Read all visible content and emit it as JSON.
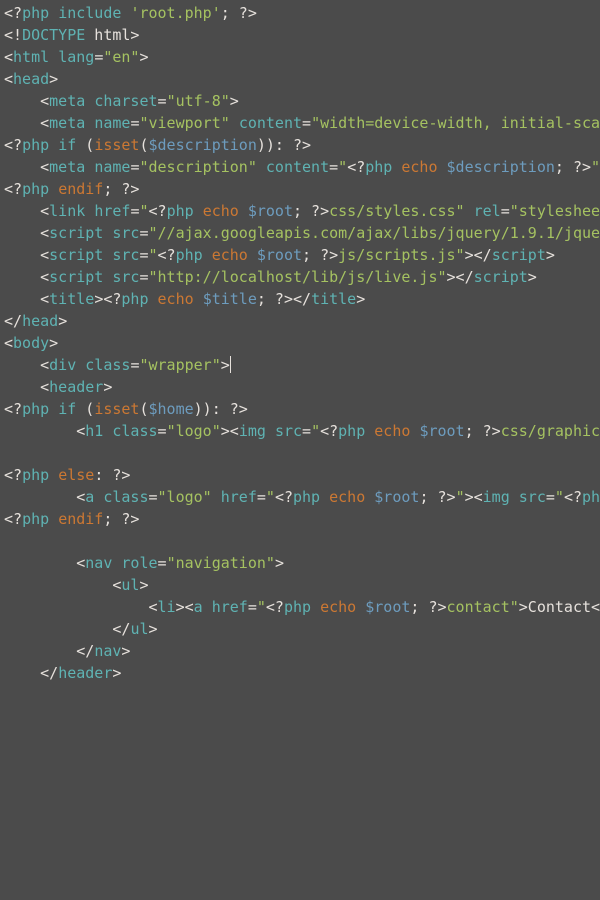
{
  "code": {
    "lines": [
      [
        {
          "cls": "c-punct",
          "t": "<?"
        },
        {
          "cls": "c-tag",
          "t": "php"
        },
        {
          "cls": "c-punct",
          "t": " "
        },
        {
          "cls": "c-tag",
          "t": "include"
        },
        {
          "cls": "c-punct",
          "t": " "
        },
        {
          "cls": "c-string",
          "t": "'root.php'"
        },
        {
          "cls": "c-punct",
          "t": "; ?>"
        }
      ],
      [
        {
          "cls": "c-punct",
          "t": "<!"
        },
        {
          "cls": "c-doctype",
          "t": "DOCTYPE"
        },
        {
          "cls": "c-punct",
          "t": " html>"
        }
      ],
      [
        {
          "cls": "c-punct",
          "t": "<"
        },
        {
          "cls": "c-tag",
          "t": "html"
        },
        {
          "cls": "c-punct",
          "t": " "
        },
        {
          "cls": "c-attr",
          "t": "lang"
        },
        {
          "cls": "c-punct",
          "t": "="
        },
        {
          "cls": "c-string",
          "t": "\"en\""
        },
        {
          "cls": "c-punct",
          "t": ">"
        }
      ],
      [
        {
          "cls": "c-punct",
          "t": "<"
        },
        {
          "cls": "c-tag",
          "t": "head"
        },
        {
          "cls": "c-punct",
          "t": ">"
        }
      ],
      [
        {
          "cls": "c-punct",
          "t": "    <"
        },
        {
          "cls": "c-tag",
          "t": "meta"
        },
        {
          "cls": "c-punct",
          "t": " "
        },
        {
          "cls": "c-attr",
          "t": "charset"
        },
        {
          "cls": "c-punct",
          "t": "="
        },
        {
          "cls": "c-string",
          "t": "\"utf-8\""
        },
        {
          "cls": "c-punct",
          "t": ">"
        }
      ],
      [
        {
          "cls": "c-punct",
          "t": "    <"
        },
        {
          "cls": "c-tag",
          "t": "meta"
        },
        {
          "cls": "c-punct",
          "t": " "
        },
        {
          "cls": "c-attr",
          "t": "name"
        },
        {
          "cls": "c-punct",
          "t": "="
        },
        {
          "cls": "c-string",
          "t": "\"viewport\""
        },
        {
          "cls": "c-punct",
          "t": " "
        },
        {
          "cls": "c-attr",
          "t": "content"
        },
        {
          "cls": "c-punct",
          "t": "="
        },
        {
          "cls": "c-string",
          "t": "\"width=device-width, initial-sca"
        }
      ],
      [
        {
          "cls": "c-punct",
          "t": "<?"
        },
        {
          "cls": "c-tag",
          "t": "php"
        },
        {
          "cls": "c-punct",
          "t": " "
        },
        {
          "cls": "c-tag",
          "t": "if"
        },
        {
          "cls": "c-punct",
          "t": " ("
        },
        {
          "cls": "c-key",
          "t": "isset"
        },
        {
          "cls": "c-punct",
          "t": "("
        },
        {
          "cls": "c-var",
          "t": "$description"
        },
        {
          "cls": "c-punct",
          "t": ")): ?>"
        }
      ],
      [
        {
          "cls": "c-punct",
          "t": "    <"
        },
        {
          "cls": "c-tag",
          "t": "meta"
        },
        {
          "cls": "c-punct",
          "t": " "
        },
        {
          "cls": "c-attr",
          "t": "name"
        },
        {
          "cls": "c-punct",
          "t": "="
        },
        {
          "cls": "c-string",
          "t": "\"description\""
        },
        {
          "cls": "c-punct",
          "t": " "
        },
        {
          "cls": "c-attr",
          "t": "content"
        },
        {
          "cls": "c-punct",
          "t": "="
        },
        {
          "cls": "c-string",
          "t": "\""
        },
        {
          "cls": "c-punct",
          "t": "<?"
        },
        {
          "cls": "c-tag",
          "t": "php"
        },
        {
          "cls": "c-punct",
          "t": " "
        },
        {
          "cls": "c-key",
          "t": "echo"
        },
        {
          "cls": "c-punct",
          "t": " "
        },
        {
          "cls": "c-var",
          "t": "$description"
        },
        {
          "cls": "c-punct",
          "t": "; ?>"
        },
        {
          "cls": "c-string",
          "t": "\""
        }
      ],
      [
        {
          "cls": "c-punct",
          "t": "<?"
        },
        {
          "cls": "c-tag",
          "t": "php"
        },
        {
          "cls": "c-punct",
          "t": " "
        },
        {
          "cls": "c-key",
          "t": "endif"
        },
        {
          "cls": "c-punct",
          "t": "; ?>"
        }
      ],
      [
        {
          "cls": "c-punct",
          "t": "    <"
        },
        {
          "cls": "c-tag",
          "t": "link"
        },
        {
          "cls": "c-punct",
          "t": " "
        },
        {
          "cls": "c-attr",
          "t": "href"
        },
        {
          "cls": "c-punct",
          "t": "="
        },
        {
          "cls": "c-string",
          "t": "\""
        },
        {
          "cls": "c-punct",
          "t": "<?"
        },
        {
          "cls": "c-tag",
          "t": "php"
        },
        {
          "cls": "c-punct",
          "t": " "
        },
        {
          "cls": "c-key",
          "t": "echo"
        },
        {
          "cls": "c-punct",
          "t": " "
        },
        {
          "cls": "c-var",
          "t": "$root"
        },
        {
          "cls": "c-punct",
          "t": "; ?>"
        },
        {
          "cls": "c-string",
          "t": "css/styles.css\""
        },
        {
          "cls": "c-punct",
          "t": " "
        },
        {
          "cls": "c-attr",
          "t": "rel"
        },
        {
          "cls": "c-punct",
          "t": "="
        },
        {
          "cls": "c-string",
          "t": "\"styleshee"
        }
      ],
      [
        {
          "cls": "c-punct",
          "t": "    <"
        },
        {
          "cls": "c-tag",
          "t": "script"
        },
        {
          "cls": "c-punct",
          "t": " "
        },
        {
          "cls": "c-attr",
          "t": "src"
        },
        {
          "cls": "c-punct",
          "t": "="
        },
        {
          "cls": "c-string",
          "t": "\"//ajax.googleapis.com/ajax/libs/jquery/1.9.1/jque"
        }
      ],
      [
        {
          "cls": "c-punct",
          "t": "    <"
        },
        {
          "cls": "c-tag",
          "t": "script"
        },
        {
          "cls": "c-punct",
          "t": " "
        },
        {
          "cls": "c-attr",
          "t": "src"
        },
        {
          "cls": "c-punct",
          "t": "="
        },
        {
          "cls": "c-string",
          "t": "\""
        },
        {
          "cls": "c-punct",
          "t": "<?"
        },
        {
          "cls": "c-tag",
          "t": "php"
        },
        {
          "cls": "c-punct",
          "t": " "
        },
        {
          "cls": "c-key",
          "t": "echo"
        },
        {
          "cls": "c-punct",
          "t": " "
        },
        {
          "cls": "c-var",
          "t": "$root"
        },
        {
          "cls": "c-punct",
          "t": "; ?>"
        },
        {
          "cls": "c-string",
          "t": "js/scripts.js\""
        },
        {
          "cls": "c-punct",
          "t": "></"
        },
        {
          "cls": "c-tag",
          "t": "script"
        },
        {
          "cls": "c-punct",
          "t": ">"
        }
      ],
      [
        {
          "cls": "c-punct",
          "t": "    <"
        },
        {
          "cls": "c-tag",
          "t": "script"
        },
        {
          "cls": "c-punct",
          "t": " "
        },
        {
          "cls": "c-attr",
          "t": "src"
        },
        {
          "cls": "c-punct",
          "t": "="
        },
        {
          "cls": "c-string",
          "t": "\"http://localhost/lib/js/live.js\""
        },
        {
          "cls": "c-punct",
          "t": "></"
        },
        {
          "cls": "c-tag",
          "t": "script"
        },
        {
          "cls": "c-punct",
          "t": ">"
        }
      ],
      [
        {
          "cls": "c-punct",
          "t": "    <"
        },
        {
          "cls": "c-tag",
          "t": "title"
        },
        {
          "cls": "c-punct",
          "t": "><?"
        },
        {
          "cls": "c-tag",
          "t": "php"
        },
        {
          "cls": "c-punct",
          "t": " "
        },
        {
          "cls": "c-key",
          "t": "echo"
        },
        {
          "cls": "c-punct",
          "t": " "
        },
        {
          "cls": "c-var",
          "t": "$title"
        },
        {
          "cls": "c-punct",
          "t": "; ?></"
        },
        {
          "cls": "c-tag",
          "t": "title"
        },
        {
          "cls": "c-punct",
          "t": ">"
        }
      ],
      [
        {
          "cls": "c-punct",
          "t": "</"
        },
        {
          "cls": "c-tag",
          "t": "head"
        },
        {
          "cls": "c-punct",
          "t": ">"
        }
      ],
      [
        {
          "cls": "c-punct",
          "t": "<"
        },
        {
          "cls": "c-tag",
          "t": "body"
        },
        {
          "cls": "c-punct",
          "t": ">"
        }
      ],
      [
        {
          "cls": "c-punct",
          "t": "    <"
        },
        {
          "cls": "c-tag",
          "t": "div"
        },
        {
          "cls": "c-punct",
          "t": " "
        },
        {
          "cls": "c-attr",
          "t": "class"
        },
        {
          "cls": "c-punct",
          "t": "="
        },
        {
          "cls": "c-string",
          "t": "\"wrapper\""
        },
        {
          "cls": "c-punct",
          "t": ">"
        },
        {
          "cursor": true
        }
      ],
      [
        {
          "cls": "c-punct",
          "t": "    <"
        },
        {
          "cls": "c-tag",
          "t": "header"
        },
        {
          "cls": "c-punct",
          "t": ">"
        }
      ],
      [
        {
          "cls": "c-punct",
          "t": "<?"
        },
        {
          "cls": "c-tag",
          "t": "php"
        },
        {
          "cls": "c-punct",
          "t": " "
        },
        {
          "cls": "c-tag",
          "t": "if"
        },
        {
          "cls": "c-punct",
          "t": " ("
        },
        {
          "cls": "c-key",
          "t": "isset"
        },
        {
          "cls": "c-punct",
          "t": "("
        },
        {
          "cls": "c-var",
          "t": "$home"
        },
        {
          "cls": "c-punct",
          "t": ")): ?>"
        }
      ],
      [
        {
          "cls": "c-punct",
          "t": "        <"
        },
        {
          "cls": "c-tag",
          "t": "h1"
        },
        {
          "cls": "c-punct",
          "t": " "
        },
        {
          "cls": "c-attr",
          "t": "class"
        },
        {
          "cls": "c-punct",
          "t": "="
        },
        {
          "cls": "c-string",
          "t": "\"logo\""
        },
        {
          "cls": "c-punct",
          "t": "><"
        },
        {
          "cls": "c-tag",
          "t": "img"
        },
        {
          "cls": "c-punct",
          "t": " "
        },
        {
          "cls": "c-attr",
          "t": "src"
        },
        {
          "cls": "c-punct",
          "t": "="
        },
        {
          "cls": "c-string",
          "t": "\""
        },
        {
          "cls": "c-punct",
          "t": "<?"
        },
        {
          "cls": "c-tag",
          "t": "php"
        },
        {
          "cls": "c-punct",
          "t": " "
        },
        {
          "cls": "c-key",
          "t": "echo"
        },
        {
          "cls": "c-punct",
          "t": " "
        },
        {
          "cls": "c-var",
          "t": "$root"
        },
        {
          "cls": "c-punct",
          "t": "; ?>"
        },
        {
          "cls": "c-string",
          "t": "css/graphic"
        }
      ],
      [
        {
          "cls": "c-punct",
          "t": ""
        }
      ],
      [
        {
          "cls": "c-punct",
          "t": "<?"
        },
        {
          "cls": "c-tag",
          "t": "php"
        },
        {
          "cls": "c-punct",
          "t": " "
        },
        {
          "cls": "c-key",
          "t": "else"
        },
        {
          "cls": "c-punct",
          "t": ": ?>"
        }
      ],
      [
        {
          "cls": "c-punct",
          "t": "        <"
        },
        {
          "cls": "c-tag",
          "t": "a"
        },
        {
          "cls": "c-punct",
          "t": " "
        },
        {
          "cls": "c-attr",
          "t": "class"
        },
        {
          "cls": "c-punct",
          "t": "="
        },
        {
          "cls": "c-string",
          "t": "\"logo\""
        },
        {
          "cls": "c-punct",
          "t": " "
        },
        {
          "cls": "c-attr",
          "t": "href"
        },
        {
          "cls": "c-punct",
          "t": "="
        },
        {
          "cls": "c-string",
          "t": "\""
        },
        {
          "cls": "c-punct",
          "t": "<?"
        },
        {
          "cls": "c-tag",
          "t": "php"
        },
        {
          "cls": "c-punct",
          "t": " "
        },
        {
          "cls": "c-key",
          "t": "echo"
        },
        {
          "cls": "c-punct",
          "t": " "
        },
        {
          "cls": "c-var",
          "t": "$root"
        },
        {
          "cls": "c-punct",
          "t": "; ?>"
        },
        {
          "cls": "c-string",
          "t": "\""
        },
        {
          "cls": "c-punct",
          "t": "><"
        },
        {
          "cls": "c-tag",
          "t": "img"
        },
        {
          "cls": "c-punct",
          "t": " "
        },
        {
          "cls": "c-attr",
          "t": "src"
        },
        {
          "cls": "c-punct",
          "t": "="
        },
        {
          "cls": "c-string",
          "t": "\""
        },
        {
          "cls": "c-punct",
          "t": "<?"
        },
        {
          "cls": "c-tag",
          "t": "ph"
        }
      ],
      [
        {
          "cls": "c-punct",
          "t": "<?"
        },
        {
          "cls": "c-tag",
          "t": "php"
        },
        {
          "cls": "c-punct",
          "t": " "
        },
        {
          "cls": "c-key",
          "t": "endif"
        },
        {
          "cls": "c-punct",
          "t": "; ?>"
        }
      ],
      [
        {
          "cls": "c-punct",
          "t": ""
        }
      ],
      [
        {
          "cls": "c-punct",
          "t": "        <"
        },
        {
          "cls": "c-tag",
          "t": "nav"
        },
        {
          "cls": "c-punct",
          "t": " "
        },
        {
          "cls": "c-attr",
          "t": "role"
        },
        {
          "cls": "c-punct",
          "t": "="
        },
        {
          "cls": "c-string",
          "t": "\"navigation\""
        },
        {
          "cls": "c-punct",
          "t": ">"
        }
      ],
      [
        {
          "cls": "c-punct",
          "t": "            <"
        },
        {
          "cls": "c-tag",
          "t": "ul"
        },
        {
          "cls": "c-punct",
          "t": ">"
        }
      ],
      [
        {
          "cls": "c-punct",
          "t": "                <"
        },
        {
          "cls": "c-tag",
          "t": "li"
        },
        {
          "cls": "c-punct",
          "t": "><"
        },
        {
          "cls": "c-tag",
          "t": "a"
        },
        {
          "cls": "c-punct",
          "t": " "
        },
        {
          "cls": "c-attr",
          "t": "href"
        },
        {
          "cls": "c-punct",
          "t": "="
        },
        {
          "cls": "c-string",
          "t": "\""
        },
        {
          "cls": "c-punct",
          "t": "<?"
        },
        {
          "cls": "c-tag",
          "t": "php"
        },
        {
          "cls": "c-punct",
          "t": " "
        },
        {
          "cls": "c-key",
          "t": "echo"
        },
        {
          "cls": "c-punct",
          "t": " "
        },
        {
          "cls": "c-var",
          "t": "$root"
        },
        {
          "cls": "c-punct",
          "t": "; ?>"
        },
        {
          "cls": "c-string",
          "t": "contact\""
        },
        {
          "cls": "c-punct",
          "t": ">Contact<"
        }
      ],
      [
        {
          "cls": "c-punct",
          "t": "            </"
        },
        {
          "cls": "c-tag",
          "t": "ul"
        },
        {
          "cls": "c-punct",
          "t": ">"
        }
      ],
      [
        {
          "cls": "c-punct",
          "t": "        </"
        },
        {
          "cls": "c-tag",
          "t": "nav"
        },
        {
          "cls": "c-punct",
          "t": ">"
        }
      ],
      [
        {
          "cls": "c-punct",
          "t": "    </"
        },
        {
          "cls": "c-tag",
          "t": "header"
        },
        {
          "cls": "c-punct",
          "t": ">"
        }
      ]
    ]
  }
}
